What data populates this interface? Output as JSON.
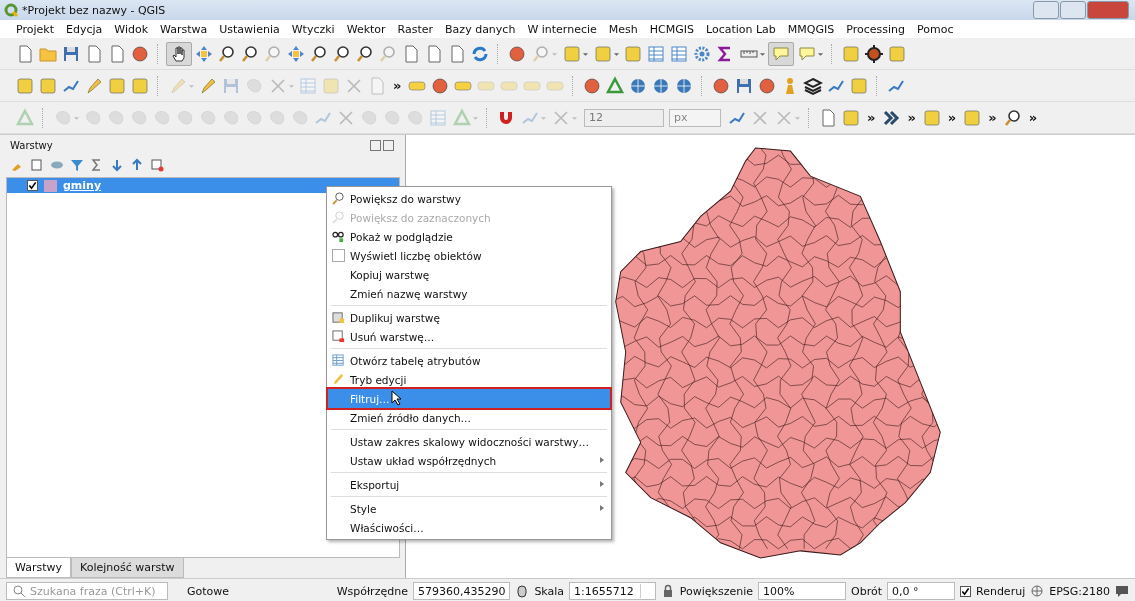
{
  "window": {
    "title": "*Projekt bez nazwy - QGIS"
  },
  "menu_bar": [
    "Projekt",
    "Edycja",
    "Widok",
    "Warstwa",
    "Ustawienia",
    "Wtyczki",
    "Wektor",
    "Raster",
    "Bazy danych",
    "W internecie",
    "Mesh",
    "HCMGIS",
    "Location Lab",
    "MMQGIS",
    "Processing",
    "Pomoc"
  ],
  "toolbars": {
    "overflow": [
      "»",
      "»",
      "»",
      "»",
      "»",
      "»"
    ],
    "size_field": {
      "value": "12"
    },
    "unit_combo": {
      "value": "px"
    }
  },
  "layers_panel": {
    "title": "Warstwy",
    "layers": [
      {
        "name": "gminy",
        "checked": true,
        "selected": true,
        "color": "#c8a2c8"
      }
    ]
  },
  "context_menu": [
    {
      "kind": "action",
      "label": "Powiększ do warstwy",
      "disabled": false,
      "selected": false,
      "submenu": false
    },
    {
      "kind": "action",
      "label": "Powiększ do zaznaczonych",
      "disabled": true,
      "selected": false,
      "submenu": false
    },
    {
      "kind": "action",
      "label": "Pokaż w podglądzie",
      "disabled": false,
      "selected": false,
      "submenu": false
    },
    {
      "kind": "checkbox",
      "label": "Wyświetl liczbę obiektów",
      "checked": false,
      "disabled": false,
      "selected": false,
      "submenu": false
    },
    {
      "kind": "action",
      "label": "Kopiuj warstwę",
      "disabled": false,
      "selected": false,
      "submenu": false
    },
    {
      "kind": "action",
      "label": "Zmień nazwę warstwy",
      "disabled": false,
      "selected": false,
      "submenu": false
    },
    {
      "kind": "separator"
    },
    {
      "kind": "action",
      "label": "Duplikuj warstwę",
      "disabled": false,
      "selected": false,
      "submenu": false
    },
    {
      "kind": "action",
      "label": "Usuń warstwę…",
      "disabled": false,
      "selected": false,
      "submenu": false
    },
    {
      "kind": "separator"
    },
    {
      "kind": "action",
      "label": "Otwórz tabelę atrybutów",
      "disabled": false,
      "selected": false,
      "submenu": false
    },
    {
      "kind": "action",
      "label": "Tryb edycji",
      "disabled": false,
      "selected": false,
      "submenu": false
    },
    {
      "kind": "action",
      "label": "Filtruj…",
      "disabled": false,
      "selected": true,
      "submenu": false
    },
    {
      "kind": "action",
      "label": "Zmień źródło danych…",
      "disabled": false,
      "selected": false,
      "submenu": false
    },
    {
      "kind": "separator"
    },
    {
      "kind": "action",
      "label": "Ustaw zakres skalowy widoczności warstwy…",
      "disabled": false,
      "selected": false,
      "submenu": false
    },
    {
      "kind": "action",
      "label": "Ustaw układ współrzędnych",
      "disabled": false,
      "selected": false,
      "submenu": true
    },
    {
      "kind": "separator"
    },
    {
      "kind": "action",
      "label": "Eksportuj",
      "disabled": false,
      "selected": false,
      "submenu": true
    },
    {
      "kind": "separator"
    },
    {
      "kind": "action",
      "label": "Style",
      "disabled": false,
      "selected": false,
      "submenu": true
    },
    {
      "kind": "action",
      "label": "Właściwości…",
      "disabled": false,
      "selected": false,
      "submenu": false
    }
  ],
  "dock_tabs": [
    {
      "label": "Warstwy",
      "selected": true
    },
    {
      "label": "Kolejność warstw",
      "selected": false
    }
  ],
  "status_bar": {
    "search": {
      "placeholder": "Szukana fraza (Ctrl+K)"
    },
    "message": "Gotowe",
    "coordinate_label": "Współrzędne",
    "coordinate": "579360,435290",
    "scale_label": "Skala",
    "scale": "1:1655712",
    "magnifier_label": "Powiększenie",
    "magnifier": "100%",
    "rotation_label": "Obrót",
    "rotation": "0,0 °",
    "render": {
      "label": "Renderuj",
      "checked": true
    },
    "crs": "EPSG:2180"
  }
}
